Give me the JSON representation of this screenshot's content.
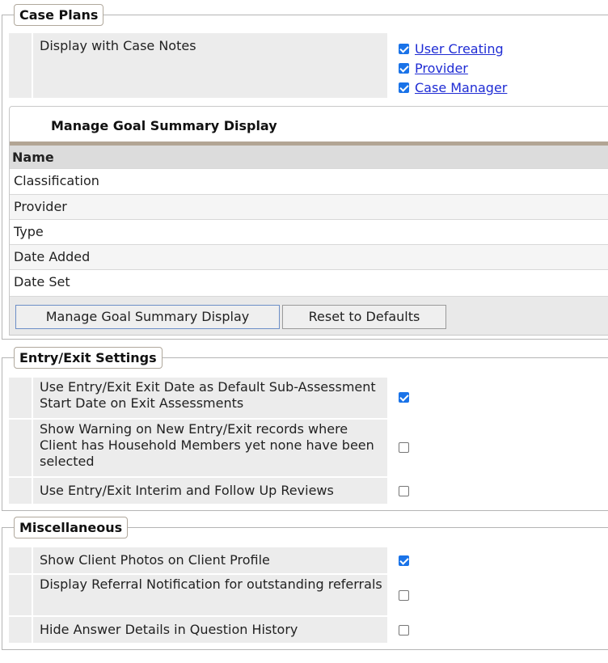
{
  "case_plans": {
    "legend": "Case Plans",
    "display_row_label": "Display with Case Notes",
    "display_options": [
      {
        "label": "User Creating",
        "checked": true
      },
      {
        "label": "Provider",
        "checked": true
      },
      {
        "label": "Case Manager",
        "checked": true
      }
    ],
    "goal_summary": {
      "title": "Manage Goal Summary Display",
      "column_header": "Name",
      "rows": [
        "Classification",
        "Provider",
        "Type",
        "Date Added",
        "Date Set"
      ],
      "manage_button": "Manage Goal Summary Display",
      "reset_button": "Reset to Defaults"
    }
  },
  "entry_exit": {
    "legend": "Entry/Exit Settings",
    "settings": [
      {
        "label": "Use Entry/Exit Exit Date as Default Sub-Assessment Start Date on Exit Assessments",
        "checked": true
      },
      {
        "label": "Show Warning on New Entry/Exit records where Client has Household Members yet none have been selected",
        "checked": false
      },
      {
        "label": "Use Entry/Exit Interim and Follow Up Reviews",
        "checked": false
      }
    ]
  },
  "misc": {
    "legend": "Miscellaneous",
    "settings": [
      {
        "label": "Show Client Photos on Client Profile",
        "checked": true
      },
      {
        "label": "Display Referral Notification for outstanding referrals",
        "checked": false
      },
      {
        "label": "Hide Answer Details in Question History",
        "checked": false
      }
    ]
  },
  "colors": {
    "checkbox_on": "#1a73e8",
    "link": "#1f2cd4",
    "rule": "#b2a594"
  }
}
